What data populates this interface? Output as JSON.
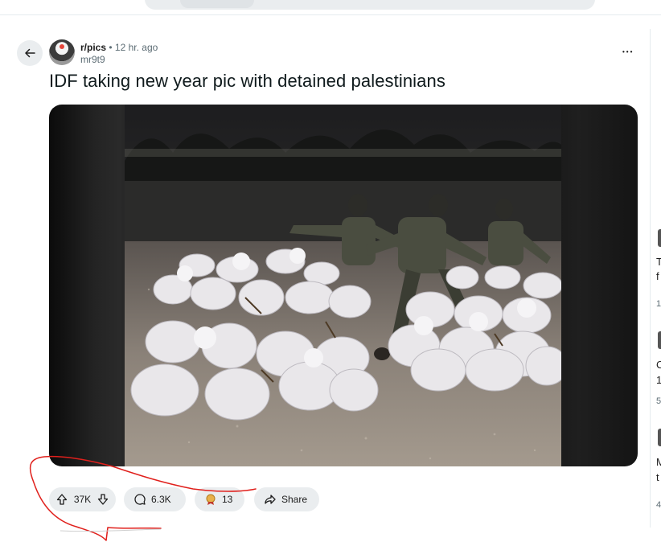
{
  "post": {
    "subreddit": "r/pics",
    "separator": "•",
    "time_ago": "12 hr. ago",
    "author": "mr9t9",
    "title": "IDF taking new year pic with detained palestinians",
    "more_menu": "•••"
  },
  "actions": {
    "upvotes": "37K",
    "comments": "6.3K",
    "awards": "13",
    "share_label": "Share"
  },
  "right_rail": {
    "letters": [
      "T",
      "f",
      "1",
      "C",
      "1",
      "5",
      "M",
      "t",
      "4"
    ]
  },
  "icons": {
    "back": "arrow-left-icon",
    "upvote": "arrow-up-icon",
    "downvote": "arrow-down-icon",
    "comment": "speech-bubble-icon",
    "award": "award-icon",
    "share": "share-arrow-icon",
    "more": "ellipsis-icon"
  },
  "colors": {
    "pill_bg": "#eaedef",
    "annotation_red": "#e0201c",
    "text": "#1c1c1c",
    "muted": "#5c6c74"
  }
}
